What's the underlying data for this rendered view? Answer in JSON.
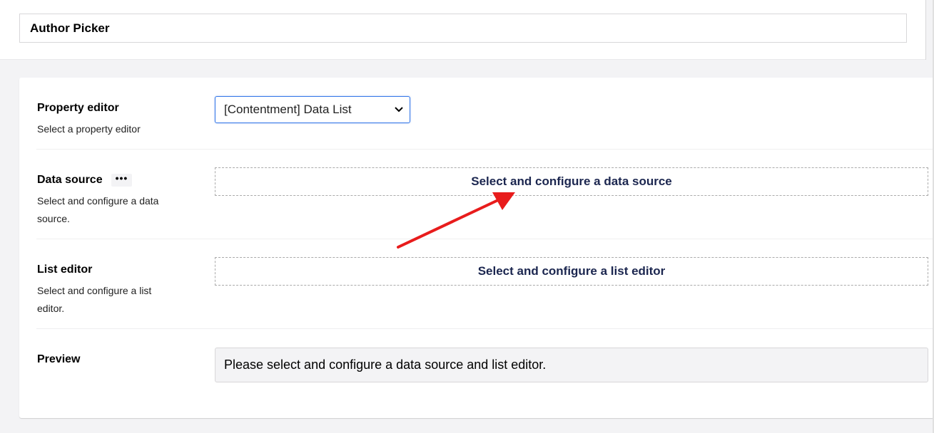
{
  "name_field": {
    "value": "Author Picker"
  },
  "property_editor": {
    "label": "Property editor",
    "description": "Select a property editor",
    "selected": "[Contentment] Data List"
  },
  "data_source": {
    "label": "Data source",
    "dots": "•••",
    "description": "Select and configure a data source.",
    "button_label": "Select and configure a data source"
  },
  "list_editor": {
    "label": "List editor",
    "description": "Select and configure a list editor.",
    "button_label": "Select and configure a list editor"
  },
  "preview": {
    "label": "Preview",
    "message": "Please select and configure a data source and list editor."
  },
  "annotation": {
    "color": "#e81c1c"
  }
}
